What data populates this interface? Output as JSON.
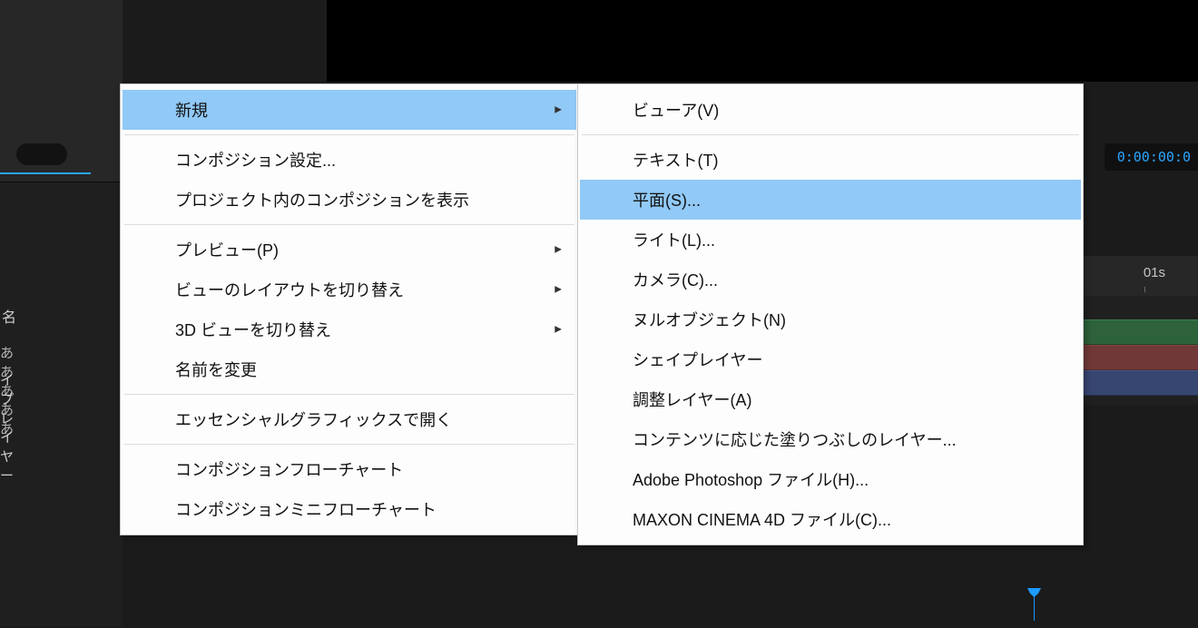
{
  "app": {
    "timecode": "0:00:00:0",
    "ruler_label": "01s",
    "source_column_header": "名",
    "layer_rows": [
      "あああああ",
      "イプレイヤー"
    ]
  },
  "menu1": {
    "items": [
      {
        "label": "新規",
        "arrow": true,
        "hover": true
      },
      {
        "sep": true
      },
      {
        "label": "コンポジション設定...",
        "arrow": false,
        "hover": false
      },
      {
        "label": "プロジェクト内のコンポジションを表示",
        "arrow": false,
        "hover": false
      },
      {
        "sep": true
      },
      {
        "label": "プレビュー(P)",
        "arrow": true,
        "hover": false
      },
      {
        "label": "ビューのレイアウトを切り替え",
        "arrow": true,
        "hover": false
      },
      {
        "label": "3D ビューを切り替え",
        "arrow": true,
        "hover": false
      },
      {
        "label": "名前を変更",
        "arrow": false,
        "hover": false
      },
      {
        "sep": true
      },
      {
        "label": "エッセンシャルグラフィックスで開く",
        "arrow": false,
        "hover": false
      },
      {
        "sep": true
      },
      {
        "label": "コンポジションフローチャート",
        "arrow": false,
        "hover": false
      },
      {
        "label": "コンポジションミニフローチャート",
        "arrow": false,
        "hover": false
      }
    ]
  },
  "menu2": {
    "items": [
      {
        "label": "ビューア(V)",
        "hover": false
      },
      {
        "sep": true
      },
      {
        "label": "テキスト(T)",
        "hover": false
      },
      {
        "label": "平面(S)...",
        "hover": true
      },
      {
        "label": "ライト(L)...",
        "hover": false
      },
      {
        "label": "カメラ(C)...",
        "hover": false
      },
      {
        "label": "ヌルオブジェクト(N)",
        "hover": false
      },
      {
        "label": "シェイプレイヤー",
        "hover": false
      },
      {
        "label": "調整レイヤー(A)",
        "hover": false
      },
      {
        "label": "コンテンツに応じた塗りつぶしのレイヤー...",
        "hover": false
      },
      {
        "label": "Adobe Photoshop ファイル(H)...",
        "hover": false
      },
      {
        "label": "MAXON CINEMA 4D ファイル(C)...",
        "hover": false
      }
    ]
  }
}
